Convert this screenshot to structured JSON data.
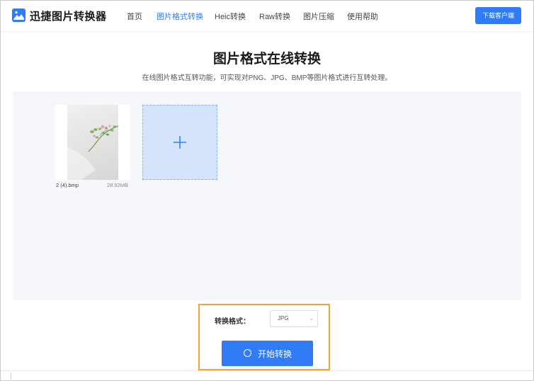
{
  "app": {
    "name": "迅捷图片转换器",
    "brand_color": "#2f7cf6",
    "logo_icon": "image-icon"
  },
  "nav": {
    "items": [
      {
        "label": "首页",
        "active": false
      },
      {
        "label": "图片格式转换",
        "active": true
      },
      {
        "label": "Heic转换",
        "active": false
      },
      {
        "label": "Raw转换",
        "active": false
      },
      {
        "label": "图片压缩",
        "active": false
      },
      {
        "label": "使用帮助",
        "active": false
      }
    ],
    "download_label": "下载客户端"
  },
  "main": {
    "title": "图片格式在线转换",
    "subtitle": "在线图片格式互转功能，可实现对PNG、JPG、BMP等图片格式进行互转处理。"
  },
  "files": [
    {
      "name": "2 (4).bmp",
      "size": "28.92MB"
    }
  ],
  "add_card": {
    "icon": "plus-icon"
  },
  "controls": {
    "format_label": "转换格式：",
    "format_value": "JPG",
    "start_label": "开始转换",
    "highlight_color": "#f0a23c"
  }
}
